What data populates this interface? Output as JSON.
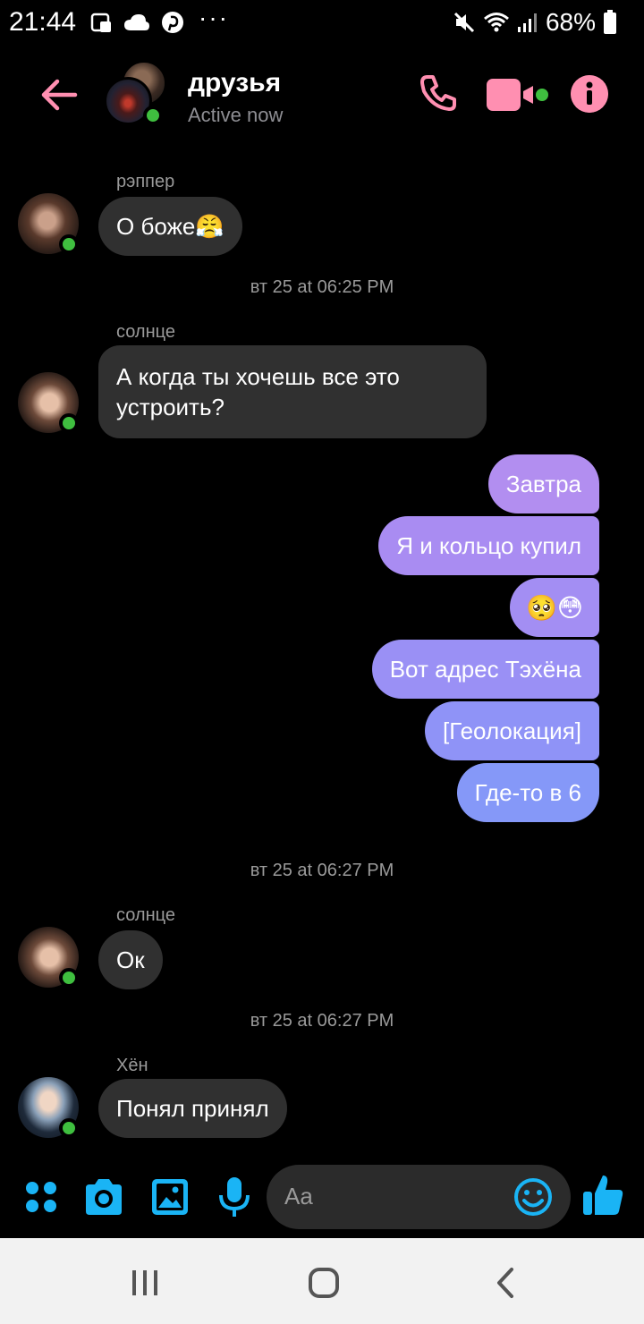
{
  "status_bar": {
    "time": "21:44",
    "dots": "···",
    "battery_pct": "68%",
    "icons_left": [
      "notification-icon",
      "cloud-icon",
      "pinterest-icon"
    ],
    "icons_right": [
      "mute-icon",
      "wifi-icon",
      "signal-icon",
      "battery-icon"
    ]
  },
  "header": {
    "title": "друзья",
    "subtitle": "Active now",
    "accent_color": "#ff8fb1",
    "icons": [
      "back-arrow-icon",
      "phone-icon",
      "video-camera-icon",
      "info-icon"
    ]
  },
  "conversation": {
    "msg1": {
      "sender": "рэппер",
      "text": "О боже😤"
    },
    "ts1": "вт 25 at 06:25 PM",
    "msg2": {
      "sender": "солнце",
      "text": "А когда ты хочешь все это устроить?"
    },
    "outgoing": [
      {
        "text": "Завтра",
        "color": "#b28ef0"
      },
      {
        "text": "Я и кольцо купил",
        "color": "#a98cf2"
      },
      {
        "text": "🥺😳",
        "color": "#a38ef3"
      },
      {
        "text": "Вот адрес Тэхёна",
        "color": "#9a90f5"
      },
      {
        "text": "[Геолокация]",
        "color": "#8f93f7"
      },
      {
        "text": "Где-то в 6",
        "color": "#8598f8"
      }
    ],
    "ts2": "вт 25 at 06:27 PM",
    "msg3": {
      "sender": "солнце",
      "text": "Ок"
    },
    "ts3": "вт 25 at 06:27 PM",
    "msg4": {
      "sender": "Хён",
      "text": "Понял принял"
    }
  },
  "composer": {
    "placeholder": "Aa",
    "accent_color": "#1ab4f5",
    "icons": [
      "apps-grid-icon",
      "camera-icon",
      "gallery-icon",
      "microphone-icon",
      "emoji-icon",
      "thumbs-up-icon"
    ]
  },
  "nav_bar": {
    "icons": [
      "recent-apps-icon",
      "home-icon",
      "back-icon"
    ]
  }
}
